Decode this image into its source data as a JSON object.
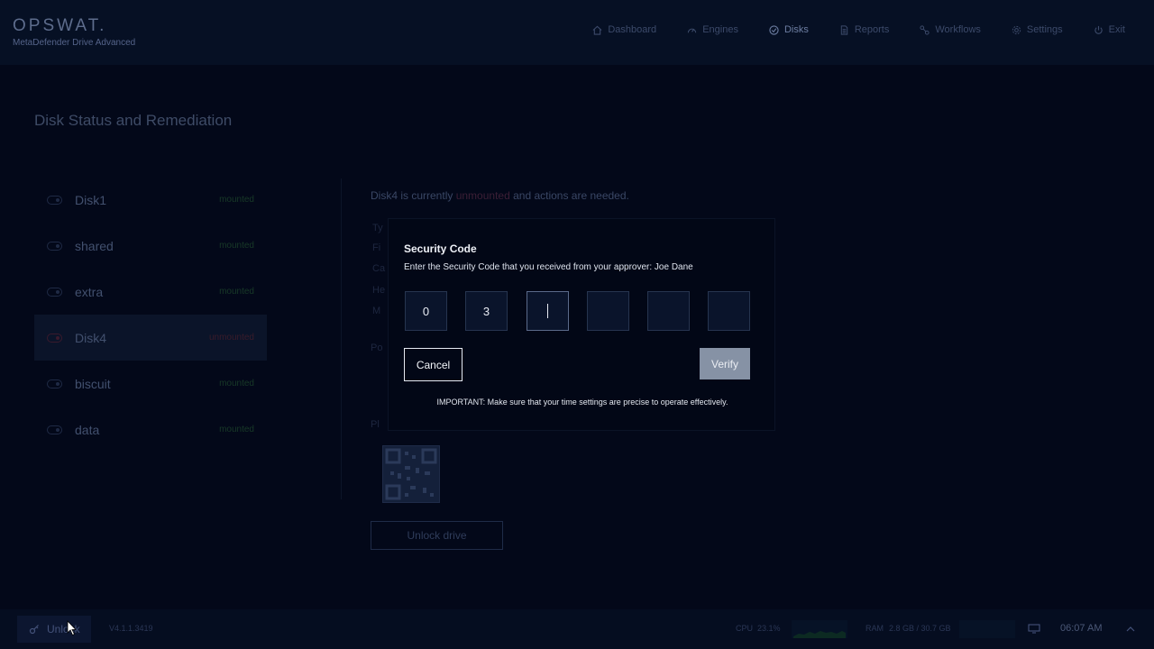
{
  "app": {
    "brand": "OPSWAT.",
    "product": "MetaDefender Drive Advanced"
  },
  "nav": [
    {
      "label": "Dashboard",
      "icon": "home-icon"
    },
    {
      "label": "Engines",
      "icon": "gauge-icon"
    },
    {
      "label": "Disks",
      "icon": "check-shield-icon",
      "active": true
    },
    {
      "label": "Reports",
      "icon": "document-icon"
    },
    {
      "label": "Workflows",
      "icon": "workflow-icon"
    },
    {
      "label": "Settings",
      "icon": "gear-icon"
    },
    {
      "label": "Exit",
      "icon": "power-icon"
    }
  ],
  "page": {
    "title": "Disk Status and Remediation"
  },
  "disks": [
    {
      "name": "Disk1",
      "status": "mounted"
    },
    {
      "name": "shared",
      "status": "mounted"
    },
    {
      "name": "extra",
      "status": "mounted"
    },
    {
      "name": "Disk4",
      "status": "unmounted",
      "selected": true
    },
    {
      "name": "biscuit",
      "status": "mounted"
    },
    {
      "name": "data",
      "status": "mounted"
    }
  ],
  "detail": {
    "prefix": "Disk4 is currently",
    "state": "unmounted",
    "suffix": "and actions are needed.",
    "partial_labels": [
      "Ty",
      "Fi",
      "Ca",
      "He",
      "M",
      "Po",
      "Pl"
    ],
    "unlock_button": "Unlock drive"
  },
  "modal": {
    "title": "Security Code",
    "message": "Enter the Security Code that you received from your approver: Joe Dane",
    "code": [
      "0",
      "3",
      "",
      "",
      "",
      ""
    ],
    "cancel": "Cancel",
    "verify": "Verify",
    "note": "IMPORTANT: Make sure that your time settings are precise to operate effectively."
  },
  "footer": {
    "unlock": "Unlock",
    "version": "V4.1.1.3419",
    "cpu_label": "CPU",
    "cpu_value": "23.1%",
    "ram_label": "RAM",
    "ram_value": "2.8 GB / 30.7 GB",
    "time": "06:07 AM"
  },
  "colors": {
    "background": "#030819",
    "mounted": "#183a28",
    "unmounted": "#3b1c2a",
    "verify_button": "#8692a5"
  }
}
